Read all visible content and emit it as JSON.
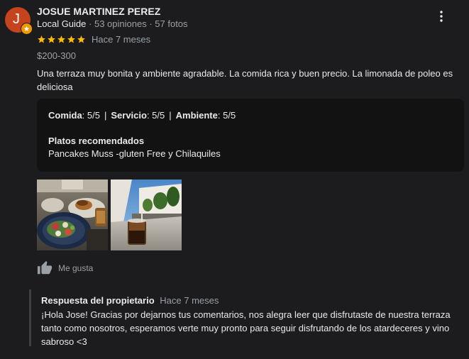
{
  "reviewer": {
    "initial": "J",
    "name": "JOSUE MARTINEZ PEREZ",
    "badge": "Local Guide",
    "reviews_count": "53 opiniones",
    "photos_count": "57 fotos",
    "avatar_color": "#c5441e",
    "badge_color": "#f29900"
  },
  "review": {
    "rating": 5,
    "rating_max": 5,
    "star_color": "#fbbc04",
    "time": "Hace 7 meses",
    "price": "$200-300",
    "text": "Una terraza muy bonita y ambiente agradable. La comida rica y buen precio. La limonada de poleo es deliciosa"
  },
  "attributes": {
    "food_label": "Comida",
    "food_value": ": 5/5",
    "service_label": "Servicio",
    "service_value": ": 5/5",
    "ambience_label": "Ambiente",
    "ambience_value": ": 5/5",
    "separator": "|",
    "dishes_title": "Platos recomendados",
    "dishes_text": "Pancakes Muss -gluten Free y Chilaquiles"
  },
  "photos": [
    {
      "icon": "food-photo"
    },
    {
      "icon": "drink-terrace-photo"
    }
  ],
  "actions": {
    "like_label": "Me gusta",
    "like_icon": "thumb-up-icon",
    "menu_icon": "more-vert-icon"
  },
  "owner_reply": {
    "title": "Respuesta del propietario",
    "time": "Hace 7 meses",
    "text": "¡Hola Jose! Gracias por dejarnos tus comentarios, nos alegra leer que disfrutaste de nuestra terraza tanto como nosotros, esperamos verte muy pronto para seguir disfrutando de los atardeceres y vino sabroso <3"
  }
}
